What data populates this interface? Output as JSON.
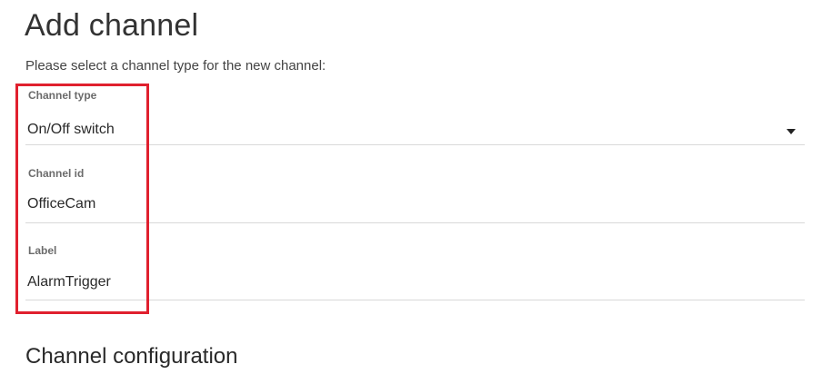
{
  "page": {
    "title": "Add channel",
    "subtitle": "Please select a channel type for the new channel:"
  },
  "fields": {
    "channel_type": {
      "label": "Channel type",
      "value": "On/Off switch"
    },
    "channel_id": {
      "label": "Channel id",
      "value": "OfficeCam"
    },
    "label": {
      "label": "Label",
      "value": "AlarmTrigger"
    }
  },
  "sections": {
    "configuration_title": "Channel configuration"
  },
  "colors": {
    "highlight": "#e0202e",
    "divider": "#d9d9d9"
  },
  "icons": {
    "dropdown": "chevron-down-icon"
  }
}
